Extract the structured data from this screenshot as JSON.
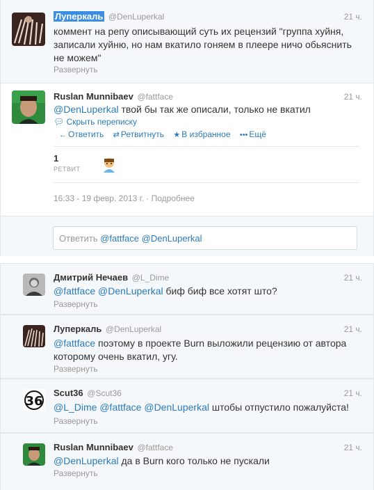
{
  "tweets": [
    {
      "fullname": "Луперкаль",
      "username": "@DenLuperkal",
      "time": "21 ч.",
      "lines": [
        "коммент на репу описывающий суть их рецензий \"группа хуйня,",
        "записали хуйню, но нам вкатило гоняем в плеере ничо обьяснить",
        "не можем\""
      ],
      "expand": "Развернуть"
    },
    {
      "fullname": "Ruslan Munnibaev",
      "username": "@fattface",
      "time": "21 ч.",
      "mention": "@DenLuperkal",
      "text": " твой бы так же описали, только не вкатил",
      "hide_conversation": "Скрыть переписку",
      "actions": {
        "reply": "Ответить",
        "retweet": "Ретвитнуть",
        "favorite": "В избранное",
        "more": "Ещё"
      },
      "stats": {
        "count": "1",
        "label": "РЕТВИТ"
      },
      "timestamp": "16:33 - 19 февр. 2013 г.",
      "details": "Подробнее",
      "reply_box": {
        "prefix": "Ответить ",
        "mentions": "@fattface @DenLuperkal"
      }
    }
  ],
  "replies": [
    {
      "fullname": "Дмитрий Нечаев",
      "username": "@L_Dime",
      "time": "21 ч.",
      "mentions": "@fattface @DenLuperkal",
      "text": " биф биф все хотят што?",
      "expand": "Развернуть"
    },
    {
      "fullname": "Луперкаль",
      "username": "@DenLuperkal",
      "time": "21 ч.",
      "mentions": "@fattface",
      "text": " поэтому в проекте Burn выложили рецензию от автора",
      "line2": "которому очень вкатил, угу.",
      "expand": "Развернуть"
    },
    {
      "fullname": "Scut36",
      "username": "@Scut36",
      "time": "21 ч.",
      "mentions": "@L_Dime @fattface @DenLuperkal",
      "text": " штобы отпустило пожалуйста!",
      "expand": "Развернуть"
    },
    {
      "fullname": "Ruslan Munnibaev",
      "username": "@fattface",
      "time": "21 ч.",
      "mentions": "@DenLuperkal",
      "text": " да в Burn кого только не пускали",
      "expand": "Развернуть"
    }
  ],
  "colors": {
    "link": "#2b7bb9",
    "muted": "#999999",
    "highlight": "#3b8ee6",
    "background": "#f5f8fa"
  }
}
